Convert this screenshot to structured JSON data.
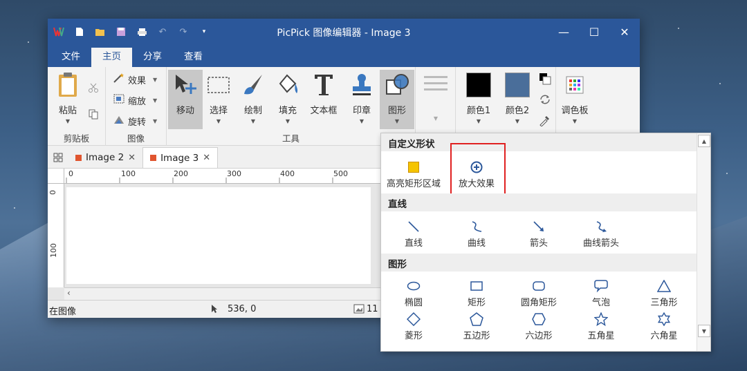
{
  "window": {
    "title": "PicPick 图像编辑器 - Image 3",
    "minimize": "—",
    "maximize": "☐",
    "close": "✕"
  },
  "menu": [
    "文件",
    "主页",
    "分享",
    "查看"
  ],
  "ribbon": {
    "clipboard": {
      "paste": "粘贴",
      "group": "剪贴板"
    },
    "image": {
      "effect": "效果",
      "zoom": "缩放",
      "rotate": "旋转",
      "group": "图像"
    },
    "tools": {
      "group": "工具",
      "items": [
        "移动",
        "选择",
        "绘制",
        "填充",
        "文本框",
        "印章",
        "图形"
      ]
    },
    "colors": {
      "color1": "颜色1",
      "color2": "颜色2",
      "palette": "调色板",
      "color1_hex": "#000000",
      "color2_hex": "#4a6e9a"
    }
  },
  "tabs": [
    {
      "label": "Image 2",
      "close": "✕"
    },
    {
      "label": "Image 3",
      "close": "✕"
    }
  ],
  "rulers": {
    "h": [
      "0",
      "100",
      "200",
      "300",
      "400",
      "500"
    ],
    "v": [
      "0",
      "100"
    ]
  },
  "status": {
    "left": "在图像",
    "coords": "536, 0",
    "size": "11"
  },
  "dropdown": {
    "sections": {
      "custom": "自定义形状",
      "line": "直线",
      "shape": "图形"
    },
    "custom_items": [
      "高亮矩形区域",
      "放大效果"
    ],
    "line_items": [
      "直线",
      "曲线",
      "箭头",
      "曲线箭头"
    ],
    "shape_items_row1": [
      "椭圆",
      "矩形",
      "圆角矩形",
      "气泡",
      "三角形"
    ],
    "shape_items_row2": [
      "菱形",
      "五边形",
      "六边形",
      "五角星",
      "六角星"
    ]
  }
}
